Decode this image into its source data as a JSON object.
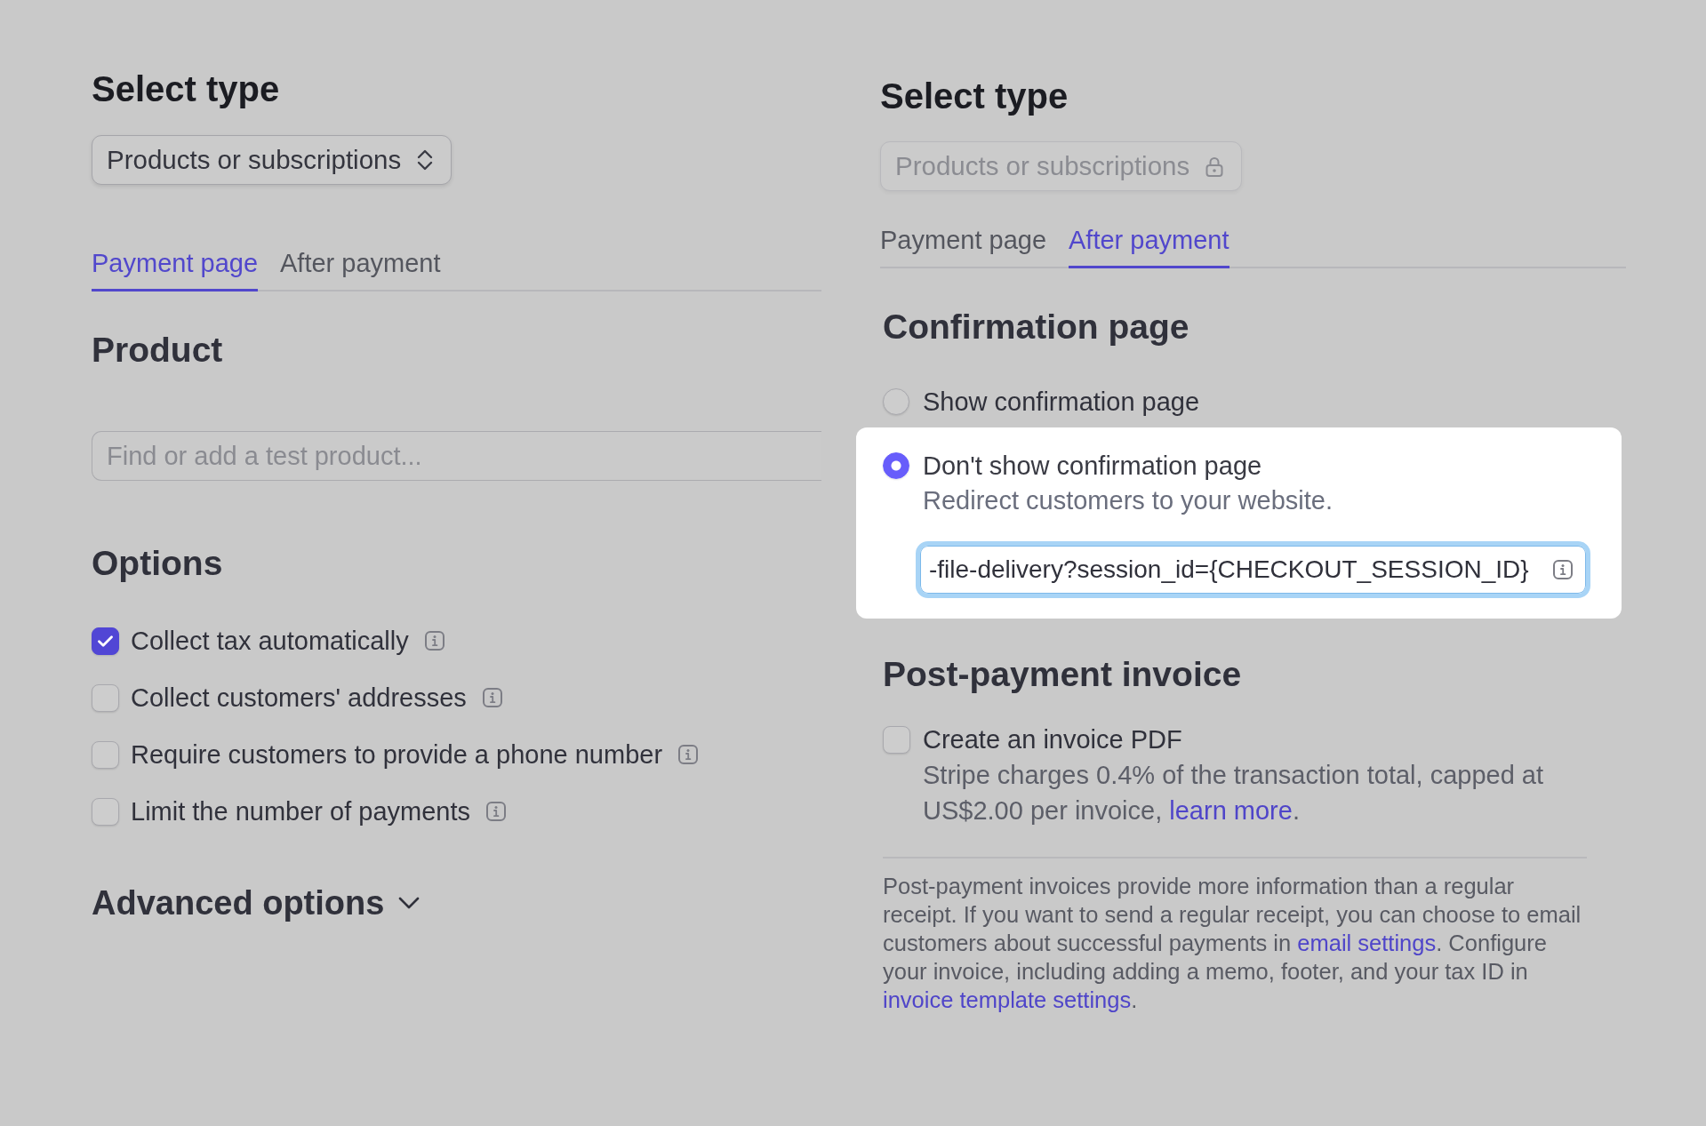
{
  "left_panel": {
    "select_type": {
      "heading": "Select type",
      "value": "Products or subscriptions",
      "disabled": false
    },
    "tabs": [
      {
        "label": "Payment page",
        "selected": true
      },
      {
        "label": "After payment",
        "selected": false
      }
    ],
    "product": {
      "heading": "Product",
      "search": {
        "placeholder": "Find or add a test product..."
      }
    },
    "options": {
      "heading": "Options",
      "items": [
        {
          "label": "Collect tax automatically",
          "checked": true
        },
        {
          "label": "Collect customers' addresses",
          "checked": false
        },
        {
          "label": "Require customers to provide a phone number",
          "checked": false
        },
        {
          "label": "Limit the number of payments",
          "checked": false
        }
      ]
    },
    "advanced_options": {
      "label": "Advanced options",
      "expanded": false
    }
  },
  "right_panel": {
    "select_type": {
      "heading": "Select type",
      "value": "Products or subscriptions",
      "disabled": true
    },
    "tabs": [
      {
        "label": "Payment page",
        "selected": false
      },
      {
        "label": "After payment",
        "selected": true
      }
    ],
    "confirmation_page": {
      "heading": "Confirmation page",
      "choices": [
        {
          "label": "Show confirmation page",
          "selected": false
        },
        {
          "label": "Don't show confirmation page",
          "selected": true,
          "description": "Redirect customers to your website.",
          "url_field": {
            "value": "-file-delivery?session_id={CHECKOUT_SESSION_ID}",
            "focused": true
          }
        }
      ]
    },
    "post_payment_invoice": {
      "heading": "Post-payment invoice",
      "checkbox": {
        "label": "Create an invoice PDF",
        "checked": false,
        "description": [
          {
            "kind": "text",
            "text": "Stripe charges 0.4% of the transaction total, capped at US$2.00 per invoice, "
          },
          {
            "kind": "link",
            "text": "learn more"
          },
          {
            "kind": "text",
            "text": "."
          }
        ]
      },
      "note": [
        {
          "kind": "text",
          "text": "Post-payment invoices provide more information than a regular receipt. If you want to send a regular receipt, you can choose to email customers about successful payments in "
        },
        {
          "kind": "link",
          "text": "email settings"
        },
        {
          "kind": "text",
          "text": ". Configure your invoice, including adding a memo, footer, and your tax ID in "
        },
        {
          "kind": "link",
          "text": "invoice template settings"
        },
        {
          "kind": "text",
          "text": "."
        }
      ]
    }
  }
}
